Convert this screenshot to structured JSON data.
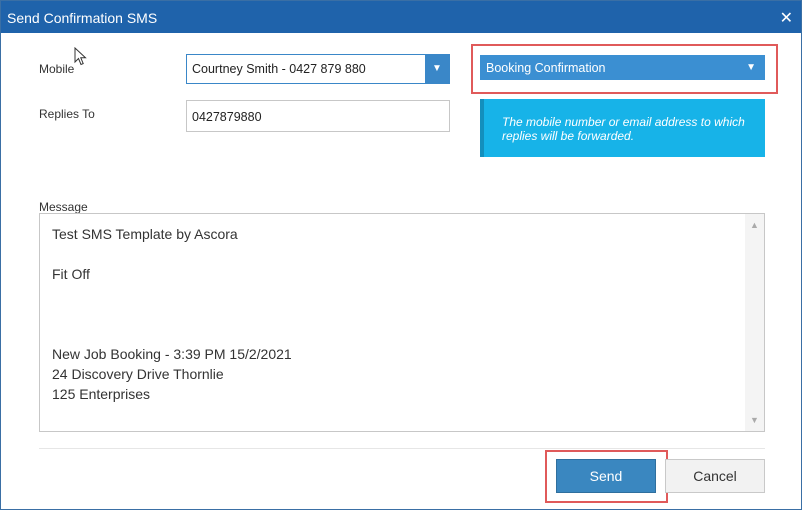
{
  "window": {
    "title": "Send Confirmation SMS",
    "close_icon": "close-icon"
  },
  "form": {
    "mobile_label": "Mobile",
    "mobile_value": "Courtney Smith - 0427 879 880",
    "replies_label": "Replies To",
    "replies_value": "0427879880",
    "template_value": "Booking Confirmation",
    "info_text": "The mobile number or email address to which replies will be forwarded.",
    "message_label": "Message",
    "message_lines": [
      "Test SMS Template by Ascora",
      "Fit Off",
      "New Job Booking - 3:39 PM 15/2/2021",
      "24 Discovery Drive Thornlie",
      "125 Enterprises"
    ]
  },
  "buttons": {
    "send": "Send",
    "cancel": "Cancel"
  },
  "colors": {
    "titlebar": "#1f63ab",
    "info_bg": "#17b3e8",
    "send_bg": "#3a87c0",
    "highlight": "#e05a5a"
  }
}
